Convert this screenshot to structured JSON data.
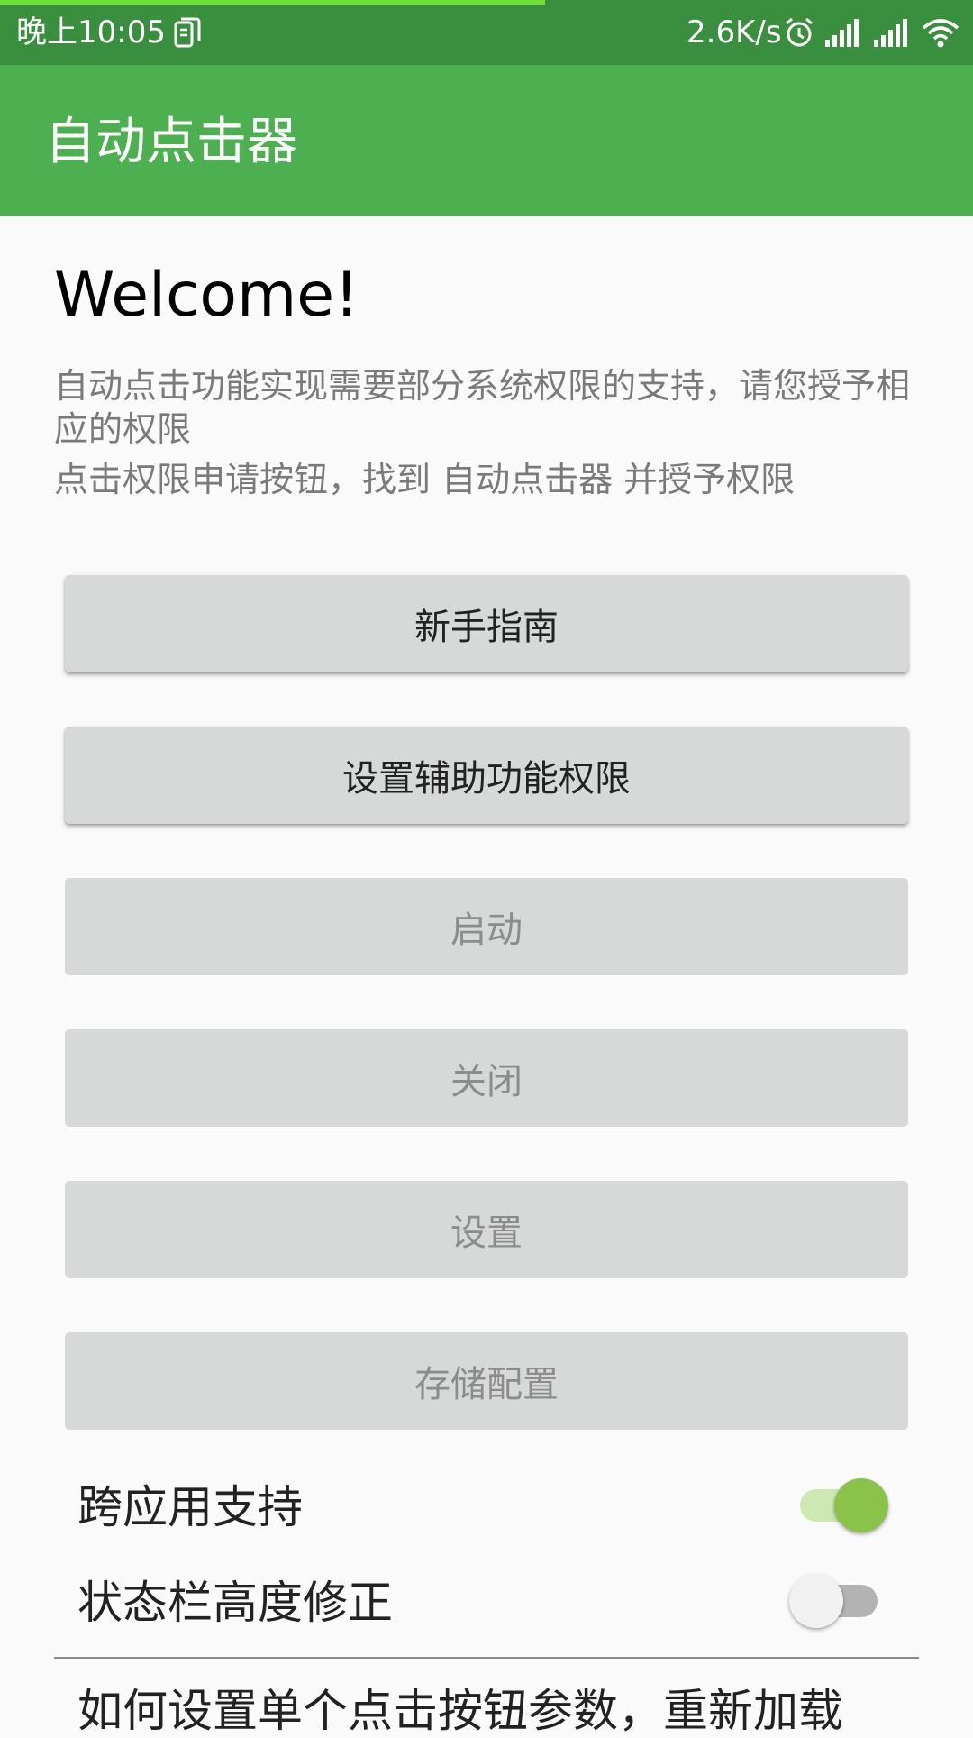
{
  "status_bar": {
    "time": "晚上10:05",
    "network_speed": "2.6K/s",
    "load_progress": 0.56,
    "icons": [
      "clipboard-icon",
      "alarm-icon",
      "signal-icon",
      "signal-icon",
      "wifi-icon"
    ]
  },
  "app_bar": {
    "title": "自动点击器"
  },
  "content": {
    "heading": "Welcome!",
    "intro_line1": "自动点击功能实现需要部分系统权限的支持，请您授予相应的权限",
    "intro_line2": "点击权限申请按钮，找到 自动点击器 并授予权限"
  },
  "buttons": {
    "guide": "新手指南",
    "accessibility": "设置辅助功能权限",
    "start": "启动",
    "stop": "关闭",
    "settings": "设置",
    "save_config": "存储配置"
  },
  "switches": {
    "cross_app": {
      "label": "跨应用支持",
      "on": true
    },
    "status_bar_fix": {
      "label": "状态栏高度修正",
      "on": false
    }
  },
  "help": {
    "text": "如何设置单个点击按钮参数，重新加载"
  },
  "colors": {
    "status_bar": "#3a8f3e",
    "app_bar": "#4caf50",
    "switch_on": "#8bc34a",
    "button_bg": "#d7d8d8"
  }
}
